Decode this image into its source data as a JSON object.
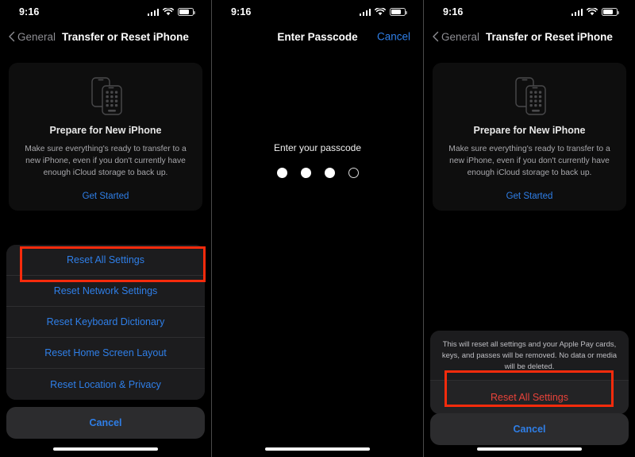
{
  "statusbar": {
    "time": "9:16",
    "signal_icon": "cellular-signal-icon",
    "wifi_icon": "wifi-icon",
    "battery_icon": "battery-icon"
  },
  "colors": {
    "accent_blue": "#2f7fe8",
    "destructive_red": "#e8433a",
    "annotation_red": "#f72b0c",
    "sheet_bg": "#1c1c1e",
    "cancel_bg": "#2c2c2e",
    "card_bg": "#0e0e0e",
    "screen_bg": "#000000"
  },
  "panel1": {
    "nav": {
      "back_label": "General",
      "title": "Transfer or Reset iPhone"
    },
    "card": {
      "illustration": "two-iphones-icon",
      "title": "Prepare for New iPhone",
      "body": "Make sure everything's ready to transfer to a new iPhone, even if you don't currently have enough iCloud storage to back up.",
      "cta": "Get Started"
    },
    "sheet_options": [
      "Reset All Settings",
      "Reset Network Settings",
      "Reset Keyboard Dictionary",
      "Reset Home Screen Layout",
      "Reset Location & Privacy"
    ],
    "cancel_label": "Cancel",
    "highlighted_option": "Reset All Settings"
  },
  "panel2": {
    "nav": {
      "title": "Enter Passcode",
      "cancel_label": "Cancel"
    },
    "prompt": "Enter your passcode",
    "passcode_length": 4,
    "passcode_entered": 3
  },
  "panel3": {
    "nav": {
      "back_label": "General",
      "title": "Transfer or Reset iPhone"
    },
    "card": {
      "illustration": "two-iphones-icon",
      "title": "Prepare for New iPhone",
      "body": "Make sure everything's ready to transfer to a new iPhone, even if you don't currently have enough iCloud storage to back up.",
      "cta": "Get Started"
    },
    "alert": {
      "message": "This will reset all settings and your Apple Pay cards, keys, and passes will be removed. No data or media will be deleted.",
      "confirm_label": "Reset All Settings",
      "cancel_label": "Cancel"
    },
    "highlighted_option": "Reset All Settings"
  }
}
